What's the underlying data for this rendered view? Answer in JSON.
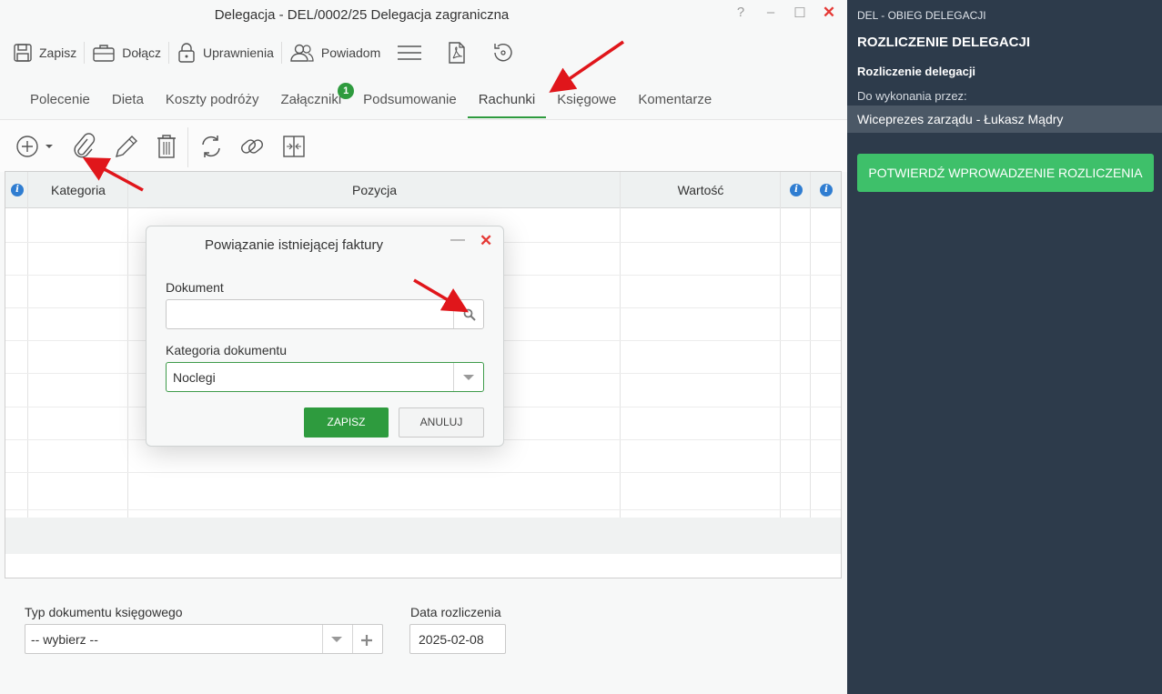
{
  "window": {
    "title": "Delegacja - DEL/0002/25 Delegacja zagraniczna",
    "help": "?",
    "minimize": "–",
    "maximize": "☐",
    "close": "✕"
  },
  "toolbar": {
    "save_label": "Zapisz",
    "attach_label": "Dołącz",
    "permissions_label": "Uprawnienia",
    "notify_label": "Powiadom"
  },
  "tabs": [
    {
      "label": "Polecenie"
    },
    {
      "label": "Dieta"
    },
    {
      "label": "Koszty podróży"
    },
    {
      "label": "Załączniki",
      "badge": "1"
    },
    {
      "label": "Podsumowanie"
    },
    {
      "label": "Rachunki",
      "active": true
    },
    {
      "label": "Księgowe"
    },
    {
      "label": "Komentarze"
    }
  ],
  "grid": {
    "columns": [
      "Kategoria",
      "Pozycja",
      "Wartość"
    ],
    "info_glyph": "i"
  },
  "form": {
    "doc_type_label": "Typ dokumentu księgowego",
    "doc_type_value": "-- wybierz --",
    "settlement_date_label": "Data rozliczenia",
    "settlement_date_value": "2025-02-08"
  },
  "dialog": {
    "title": "Powiązanie istniejącej faktury",
    "minimize": "—",
    "close": "✕",
    "document_label": "Dokument",
    "document_value": "",
    "category_label": "Kategoria dokumentu",
    "category_value": "Noclegi",
    "save_label": "ZAPISZ",
    "cancel_label": "ANULUJ"
  },
  "sidebar": {
    "process": "DEL - OBIEG DELEGACJI",
    "stage": "ROZLICZENIE DELEGACJI",
    "step": "Rozliczenie delegacji",
    "assigned_label": "Do wykonania przez:",
    "assignee": "Wiceprezes zarządu - Łukasz Mądry",
    "confirm_label": "POTWIERDŹ WPROWADZENIE ROZLICZENIA"
  },
  "colors": {
    "accent_green": "#2e9b3e",
    "sidebar_bg": "#2d3b4b",
    "confirm_green": "#3ec06a",
    "arrow_red": "#e0161b",
    "info_blue": "#2f7dd1"
  }
}
